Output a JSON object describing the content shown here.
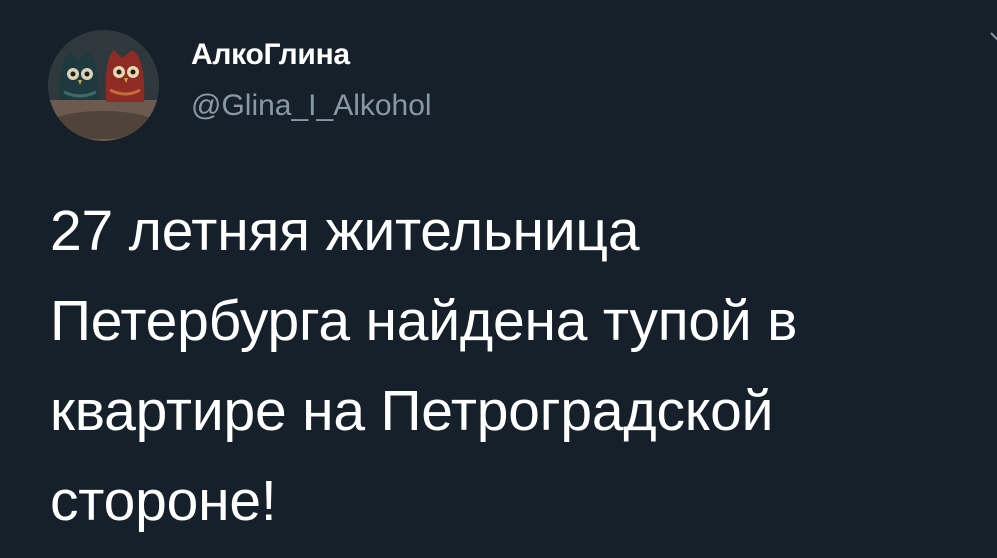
{
  "author": {
    "display_name": "АлкоГлина",
    "handle": "@Glina_I_Alkohol",
    "avatar_icon": "owl-figurines-avatar"
  },
  "menu": {
    "icon": "chevron-down-icon"
  },
  "tweet": {
    "lines": [
      "27 летняя жительница",
      "Петербурга найдена тупой в",
      "квартире на Петроградской",
      "стороне!"
    ]
  },
  "colors": {
    "background": "#15202b",
    "primary_text": "#ffffff",
    "secondary_text": "#8899a6"
  }
}
